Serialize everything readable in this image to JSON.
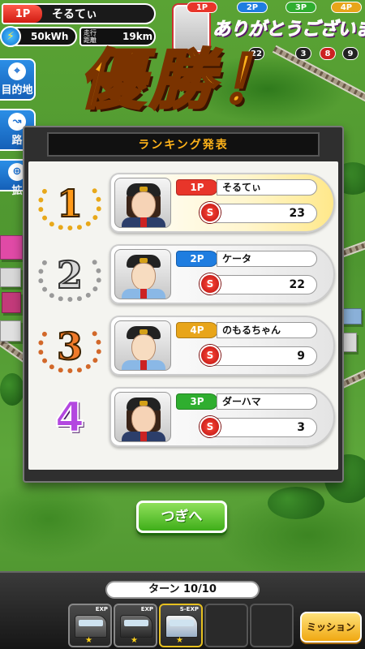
{
  "hud": {
    "player_badge": "1P",
    "player_name": "そるてぃ",
    "energy": "50kWh",
    "distance_label": "走行距離",
    "distance": "19km"
  },
  "top_right": {
    "badges": [
      "1P",
      "2P",
      "3P",
      "4P"
    ],
    "banner": "ありがとうございました",
    "scores": [
      "22",
      "3",
      "8",
      "9"
    ]
  },
  "side_menu": {
    "destination": "目的地",
    "route": "路",
    "expand": "拡"
  },
  "victory_title": "優勝！",
  "ranking": {
    "title": "ランキング発表",
    "rows": [
      {
        "rank": "1",
        "badge": "1P",
        "name": "そるてぃ",
        "score": "23",
        "badge_color": "#e8352a",
        "card_color": "#fff6cf"
      },
      {
        "rank": "2",
        "badge": "2P",
        "name": "ケータ",
        "score": "22",
        "badge_color": "#1f7de0",
        "card_color": "#f2f2f2"
      },
      {
        "rank": "3",
        "badge": "4P",
        "name": "のもるちゃん",
        "score": "9",
        "badge_color": "#e8a51a",
        "card_color": "#f2f2f2"
      },
      {
        "rank": "4",
        "badge": "3P",
        "name": "ダーハマ",
        "score": "3",
        "badge_color": "#2fae2f",
        "card_color": "#f2f2f2"
      }
    ],
    "score_icon": "S"
  },
  "next_button": "つぎへ",
  "bottom": {
    "turn": "ターン 10/10",
    "slot_tags": [
      "EXP",
      "EXP",
      "S-EXP"
    ],
    "mission": "ミッション"
  },
  "colors": {
    "p1": "#e8352a",
    "p2": "#1f7de0",
    "p3": "#2fae2f",
    "p4": "#e8a51a",
    "gold": "#ffb21a",
    "panel_title": "#ffb31a"
  }
}
